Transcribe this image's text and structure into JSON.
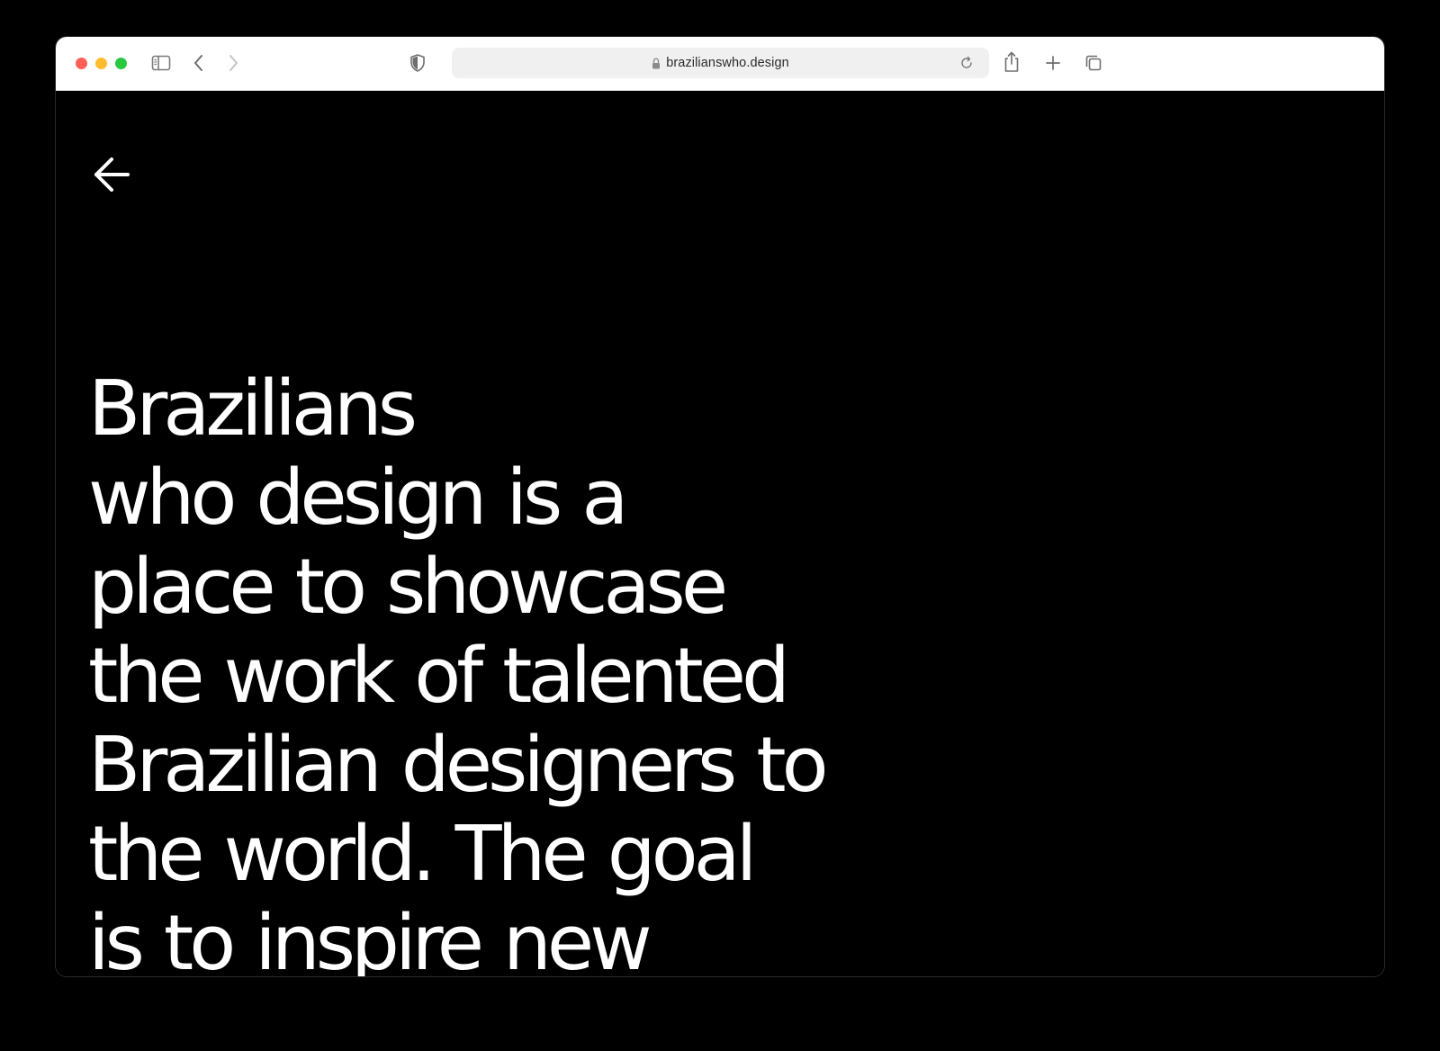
{
  "browser": {
    "address_bar": {
      "url": "brazilianswho.design"
    },
    "toolbar_icons": [
      "sidebar-icon",
      "back-icon",
      "forward-icon",
      "shield-icon",
      "lock-icon",
      "reload-icon",
      "share-icon",
      "new-tab-icon",
      "tab-overview-icon"
    ]
  },
  "page": {
    "background_color": "#000000",
    "text_color": "#ffffff",
    "back_icon": "arrow-left-icon",
    "intro_text": "Brazilians\nwho design is a\nplace to showcase\nthe work of talented\nBrazilian designers to\nthe world. The goal\nis to inspire new"
  }
}
